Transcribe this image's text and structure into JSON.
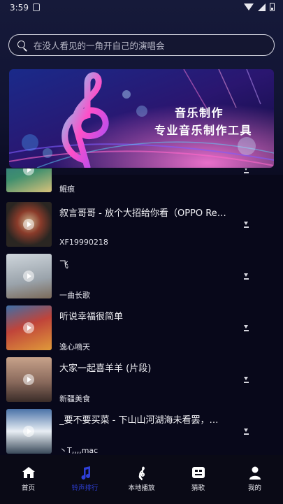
{
  "status_bar": {
    "time": "3:59"
  },
  "search": {
    "placeholder": "在没人看见的一角开自己的演唱会"
  },
  "banner": {
    "line1": "音乐制作",
    "line2": "专业音乐制作工具"
  },
  "songs": [
    {
      "title": "",
      "artist": "鲲痕",
      "thumb_colors": [
        "#2b6e8c",
        "#3f8f6e",
        "#d9c27a"
      ]
    },
    {
      "title": "叙言哥哥 - 放个大招给你看（OPPO Rean ...",
      "artist": "XF19990218",
      "thumb_colors": [
        "#2a2622",
        "#8a3b2a",
        "#c9b08a"
      ]
    },
    {
      "title": "飞",
      "artist": "一曲长歌",
      "thumb_colors": [
        "#cfd6dc",
        "#9aa3ab",
        "#7b6a5a"
      ]
    },
    {
      "title": "听说幸福很简单",
      "artist": "逸心嘀天",
      "thumb_colors": [
        "#c0443a",
        "#e09a3a",
        "#3d6fa8"
      ]
    },
    {
      "title": "大家一起喜羊羊 (片段)",
      "artist": "新疆美食",
      "thumb_colors": [
        "#8a6a5c",
        "#c7a28a",
        "#3a2c28"
      ]
    },
    {
      "title": "_要不要买菜 - 下山山河湖海未看罢，儿女...",
      "artist": "丶T,,,,mac",
      "thumb_colors": [
        "#4a72a8",
        "#e8eef4",
        "#3a4a5a"
      ]
    }
  ],
  "bottom_nav": {
    "tabs": [
      {
        "label": "首页",
        "icon": "home-icon",
        "active": false
      },
      {
        "label": "铃声排行",
        "icon": "music-note-icon",
        "active": true
      },
      {
        "label": "本地播放",
        "icon": "treble-clef-icon",
        "active": false
      },
      {
        "label": "猜歌",
        "icon": "quiz-icon",
        "active": false
      },
      {
        "label": "我的",
        "icon": "profile-icon",
        "active": false
      }
    ]
  },
  "colors": {
    "accent": "#2e3fd6",
    "background": "#08081a"
  }
}
